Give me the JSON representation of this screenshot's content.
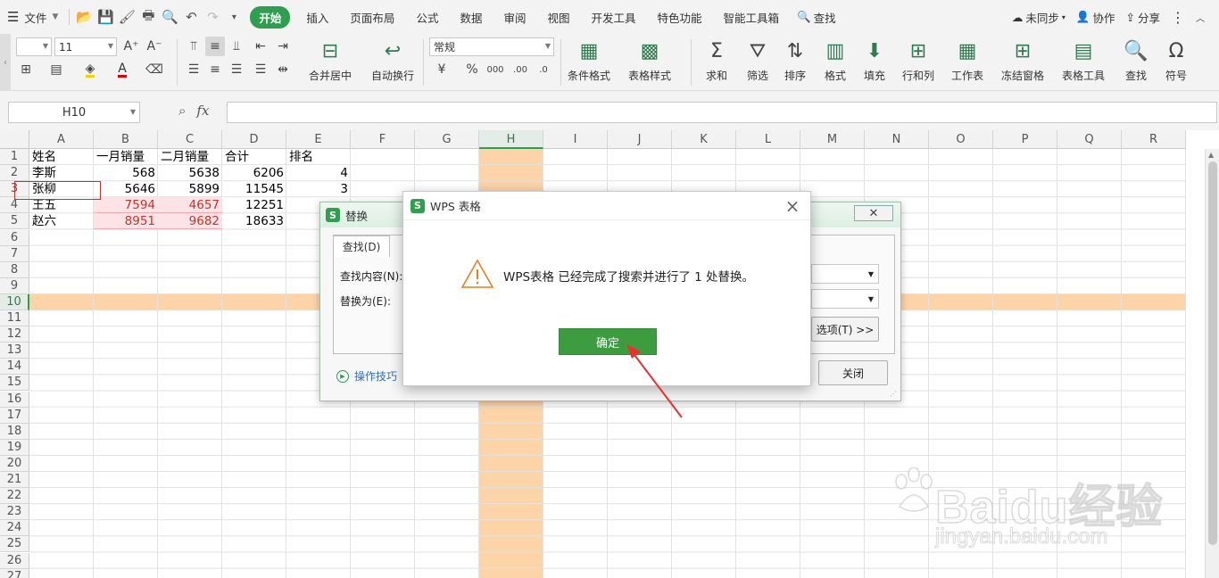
{
  "menubar": {
    "file_label": "文件",
    "tabs": [
      "开始",
      "插入",
      "页面布局",
      "公式",
      "数据",
      "审阅",
      "视图",
      "开发工具",
      "特色功能",
      "智能工具箱"
    ],
    "search_label": "查找",
    "sync_label": "未同步",
    "collab_label": "协作",
    "share_label": "分享"
  },
  "ribbon": {
    "font_name": "",
    "font_size": "11",
    "number_format": "常规",
    "merge_label": "合并居中",
    "wrap_label": "自动换行",
    "cond_format_label": "条件格式",
    "table_style_label": "表格样式",
    "sum_label": "求和",
    "filter_label": "筛选",
    "sort_label": "排序",
    "format_label": "格式",
    "fill_label": "填充",
    "rowcol_label": "行和列",
    "sheet_label": "工作表",
    "freeze_label": "冻结窗格",
    "tabletools_label": "表格工具",
    "find_label": "查找",
    "symbol_label": "符号"
  },
  "formula_bar": {
    "cell_ref": "H10",
    "fx": "fx",
    "formula": ""
  },
  "sheet": {
    "columns": [
      "A",
      "B",
      "C",
      "D",
      "E",
      "F",
      "G",
      "H",
      "I",
      "J",
      "K",
      "L",
      "M",
      "N",
      "O",
      "P",
      "Q",
      "R"
    ],
    "rows": [
      "1",
      "2",
      "3",
      "4",
      "5",
      "6",
      "7",
      "8",
      "9",
      "10",
      "11",
      "12",
      "13",
      "14",
      "15",
      "16",
      "17",
      "18",
      "19",
      "20",
      "21",
      "22",
      "23",
      "24",
      "25",
      "26",
      "27"
    ],
    "header_row": [
      "姓名",
      "一月销量",
      "二月销量",
      "合计",
      "排名"
    ],
    "data": [
      [
        "李斯",
        "568",
        "5638",
        "6206",
        "4"
      ],
      [
        "张柳",
        "5646",
        "5899",
        "11545",
        "3"
      ],
      [
        "王五",
        "7594",
        "4657",
        "12251",
        ""
      ],
      [
        "赵六",
        "8951",
        "9682",
        "18633",
        ""
      ]
    ],
    "selected_column": "H",
    "selected_row": "10",
    "highlight_color": "#fdd3a8"
  },
  "replace_dialog": {
    "title": "替换",
    "tab_find": "查找(D)",
    "find_label": "查找内容(N):",
    "replace_label": "替换为(E):",
    "options_button": "选项(T) >>",
    "close_button": "关闭",
    "tips_label": "操作技巧"
  },
  "message_box": {
    "title": "WPS 表格",
    "message": "WPS表格 已经完成了搜索并进行了 1 处替换。",
    "ok_button": "确定"
  },
  "watermark": {
    "brand": "Baidu经验",
    "url": "jingyan.baidu.com"
  }
}
